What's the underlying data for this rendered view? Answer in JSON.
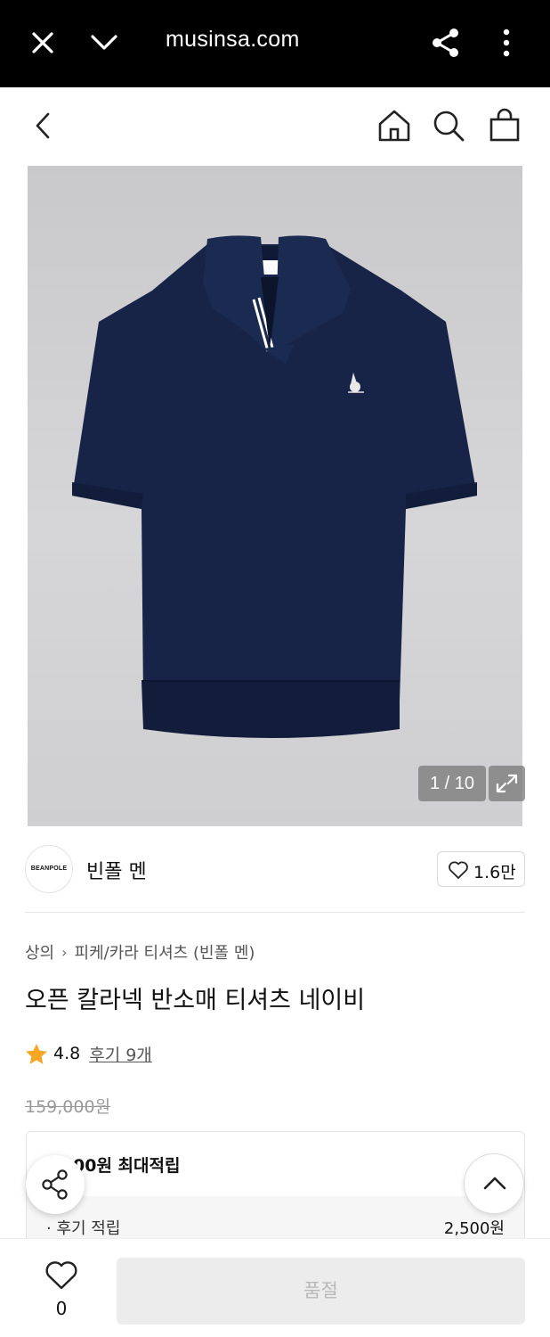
{
  "browser": {
    "url": "musinsa.com",
    "icons": [
      "close-icon",
      "chevron-down-icon",
      "share-icon",
      "more-vertical-icon"
    ]
  },
  "header": {
    "icons": [
      "back-arrow-icon",
      "home-icon",
      "search-icon",
      "shopping-bag-icon"
    ]
  },
  "gallery": {
    "counter": "1 / 10",
    "shirt_color": "#172447"
  },
  "brand": {
    "logo_text": "BEANPOLE",
    "name": "빈폴 멘",
    "likes": "1.6만"
  },
  "breadcrumb": {
    "category": "상의",
    "subcategory": "피케/카라 티셔츠 (빈폴 멘)"
  },
  "product": {
    "title": "오픈 칼라넥 반소매 티셔츠 네이비",
    "rating": "4.8",
    "reviews": "후기 9개",
    "original_price": "159,000원"
  },
  "points": {
    "title": "00원 최대적립",
    "row_label": "· 후기 적립",
    "row_value": "2,500원"
  },
  "bottom": {
    "wish_count": "0",
    "buy_label": "품절"
  },
  "colors": {
    "star": "#f5a623",
    "navy": "#172447"
  }
}
